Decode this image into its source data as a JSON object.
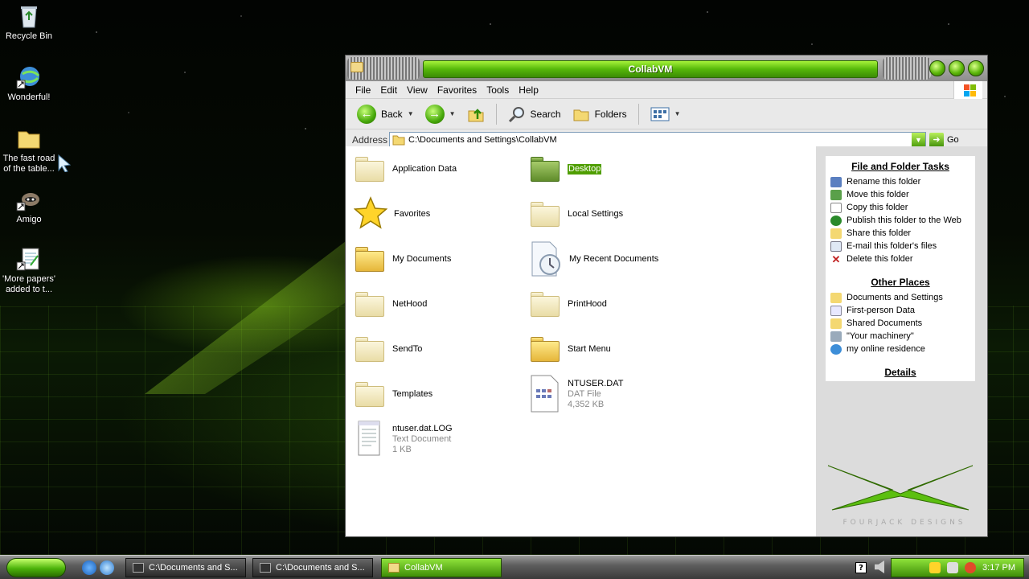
{
  "desktop": {
    "icons": [
      {
        "label": "Recycle Bin",
        "icon": "recycle-bin-icon"
      },
      {
        "label": "Wonderful!",
        "icon": "internet-shortcut-icon"
      },
      {
        "label": "The fast road of the table...",
        "icon": "folder-icon"
      },
      {
        "label": "Amigo",
        "icon": "raccoon-shortcut-icon"
      },
      {
        "label": "'More papers' added to t...",
        "icon": "notepad-shortcut-icon"
      }
    ]
  },
  "window": {
    "title": "CollabVM",
    "menu": [
      "File",
      "Edit",
      "View",
      "Favorites",
      "Tools",
      "Help"
    ],
    "toolbar": {
      "back": "Back",
      "search": "Search",
      "folders": "Folders"
    },
    "address": {
      "label": "Address",
      "value": "C:\\Documents and Settings\\CollabVM",
      "go": "Go"
    },
    "items": [
      {
        "name": "Application Data",
        "type": "folder"
      },
      {
        "name": "Desktop",
        "type": "folder",
        "selected": true
      },
      {
        "name": "Favorites",
        "type": "favorites"
      },
      {
        "name": "Local Settings",
        "type": "folder"
      },
      {
        "name": "My Documents",
        "type": "folder"
      },
      {
        "name": "My Recent Documents",
        "type": "recent"
      },
      {
        "name": "NetHood",
        "type": "folder"
      },
      {
        "name": "PrintHood",
        "type": "folder"
      },
      {
        "name": "SendTo",
        "type": "folder"
      },
      {
        "name": "Start Menu",
        "type": "folder"
      },
      {
        "name": "Templates",
        "type": "folder"
      },
      {
        "name": "NTUSER.DAT",
        "type": "file",
        "kind": "DAT File",
        "size": "4,352 KB"
      },
      {
        "name": "ntuser.dat.LOG",
        "type": "text",
        "kind": "Text Document",
        "size": "1 KB"
      }
    ],
    "tasks": {
      "file_folder_tasks": {
        "title": "File and Folder Tasks",
        "links": [
          "Rename this folder",
          "Move this folder",
          "Copy this folder",
          "Publish this folder to the Web",
          "Share this folder",
          "E-mail this folder's files",
          "Delete this folder"
        ]
      },
      "other_places": {
        "title": "Other Places",
        "links": [
          "Documents and Settings",
          "First-person Data",
          "Shared Documents",
          "\"Your machinery\"",
          "my online residence"
        ]
      },
      "details": {
        "title": "Details"
      }
    },
    "logo_text": "FOURJACK DESIGNS"
  },
  "taskbar": {
    "tasks": [
      "C:\\Documents and S...",
      "C:\\Documents and S...",
      "CollabVM"
    ],
    "clock": "3:17 PM",
    "help": "?"
  },
  "colors": {
    "accent": "#4f9e00",
    "title_green": "#56b80a"
  }
}
